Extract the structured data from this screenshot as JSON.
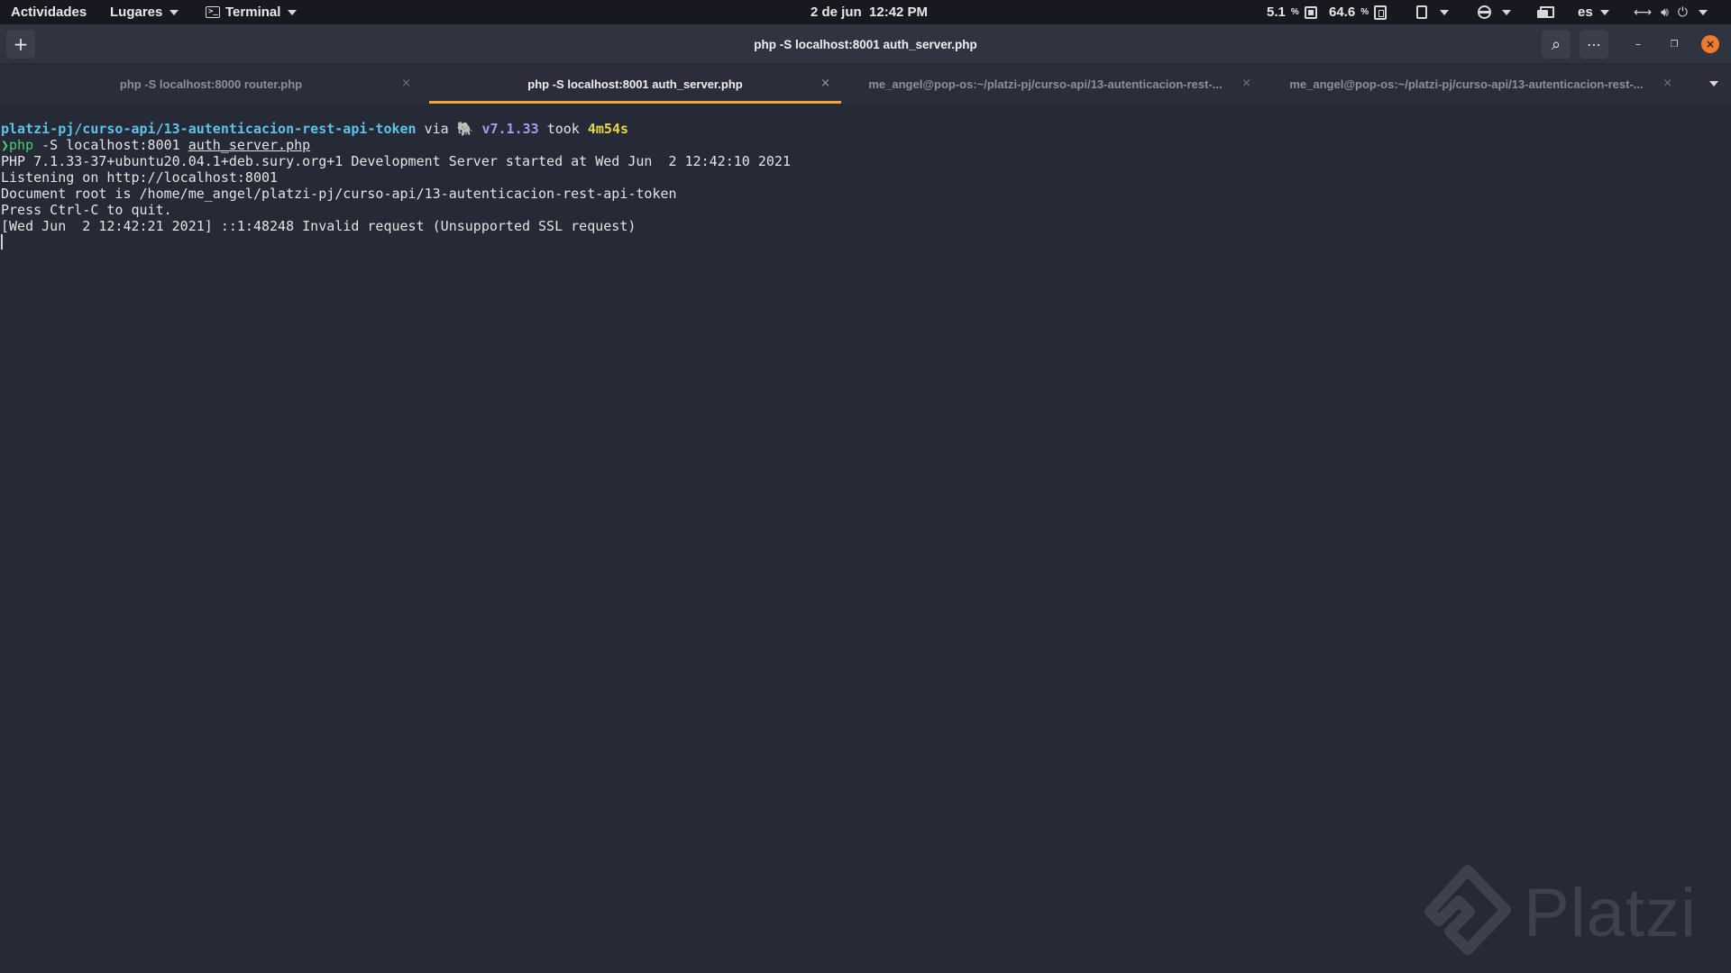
{
  "topbar": {
    "activities": "Actividades",
    "places": "Lugares",
    "app_menu": "Terminal",
    "clock": "2 de jun  12:42 PM",
    "cpu_value": "5.1",
    "cpu_unit": "%",
    "ram_value": "64.6",
    "ram_unit": "%",
    "language": "es"
  },
  "window": {
    "title": "php -S localhost:8001 auth_server.php",
    "new_tab_glyph": "+",
    "search_glyph": "⌕",
    "menu_glyph": "⋯",
    "minimize_glyph": "–",
    "maximize_glyph": "❐",
    "close_glyph": "×"
  },
  "tabs": [
    {
      "label": "php -S localhost:8000 router.php"
    },
    {
      "label": "php -S localhost:8001 auth_server.php"
    },
    {
      "label": "me_angel@pop-os:~/platzi-pj/curso-api/13-autenticacion-rest-..."
    },
    {
      "label": "me_angel@pop-os:~/platzi-pj/curso-api/13-autenticacion-rest-..."
    }
  ],
  "terminal": {
    "prompt_path": "platzi-pj/curso-api/13-autenticacion-rest-api-token",
    "via": " via ",
    "php_icon": "🐘",
    "php_version": "v7.1.33",
    "took": " took ",
    "duration": "4m54s",
    "prompt_char": "❯",
    "cmd_name": "php",
    "cmd_args": " -S localhost:8001 ",
    "cmd_file": "auth_server.php",
    "output": [
      "PHP 7.1.33-37+ubuntu20.04.1+deb.sury.org+1 Development Server started at Wed Jun  2 12:42:10 2021",
      "Listening on http://localhost:8001",
      "Document root is /home/me_angel/platzi-pj/curso-api/13-autenticacion-rest-api-token",
      "Press Ctrl-C to quit.",
      "[Wed Jun  2 12:42:21 2021] ::1:48248 Invalid request (Unsupported SSL request)"
    ]
  },
  "watermark": {
    "text": "Platzi"
  }
}
